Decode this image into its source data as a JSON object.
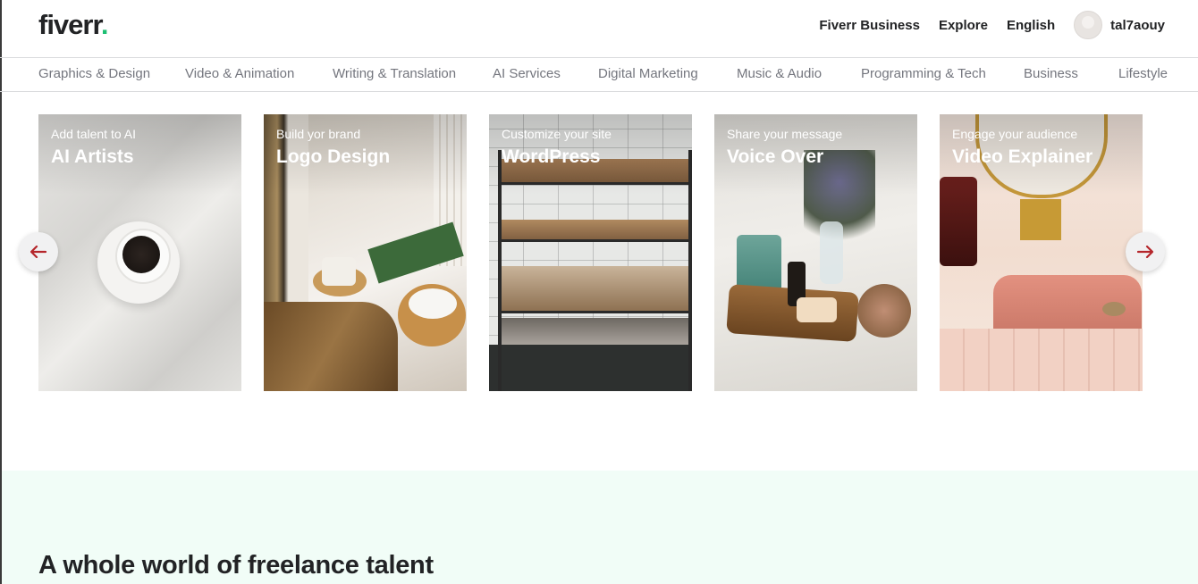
{
  "header": {
    "logo_text": "fiverr",
    "logo_dot": ".",
    "links": [
      "Fiverr Business",
      "Explore",
      "English"
    ],
    "username": "tal7aouy"
  },
  "categories": [
    "Graphics & Design",
    "Video & Animation",
    "Writing & Translation",
    "AI Services",
    "Digital Marketing",
    "Music & Audio",
    "Programming & Tech",
    "Business",
    "Lifestyle"
  ],
  "cards": [
    {
      "subtitle": "Add talent to AI",
      "title": "AI Artists"
    },
    {
      "subtitle": "Build yor brand",
      "title": "Logo Design"
    },
    {
      "subtitle": "Customize your site",
      "title": "WordPress"
    },
    {
      "subtitle": "Share your message",
      "title": "Voice Over"
    },
    {
      "subtitle": "Engage your audience",
      "title": "Video Explainer"
    }
  ],
  "carousel": {
    "prev_icon": "arrow-left-icon",
    "next_icon": "arrow-right-icon"
  },
  "talent_section": {
    "title": "A whole world of freelance talent"
  },
  "colors": {
    "brand_green": "#1dbf73",
    "arrow_red": "#b5262b",
    "section_bg": "#f1fdf7"
  }
}
